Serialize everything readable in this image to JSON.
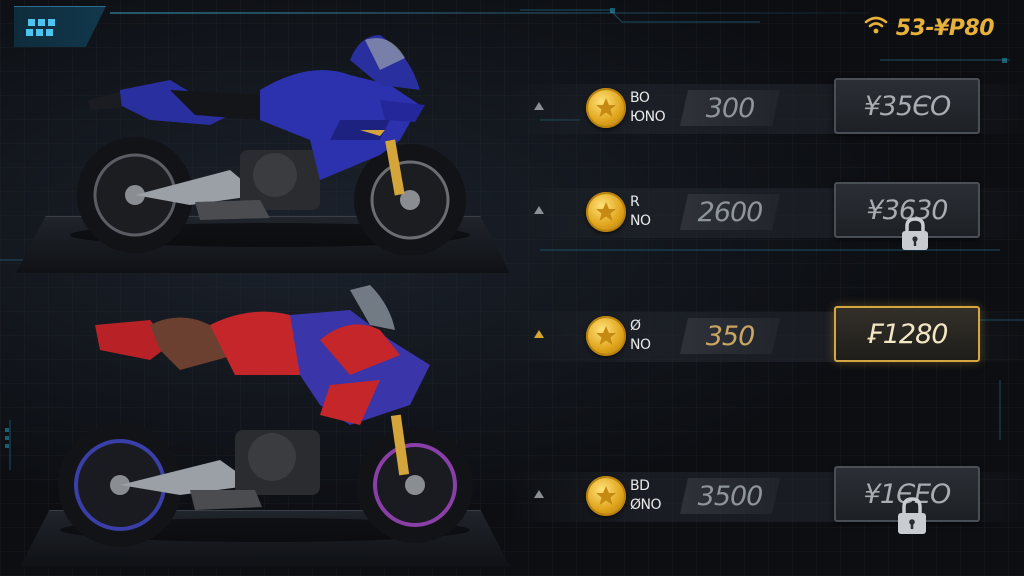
{
  "hud": {
    "menu_icon": "grid-menu-icon",
    "wifi_icon": "wifi-icon",
    "currency_text": "53-¥P80",
    "accent": "#e8b23a"
  },
  "bikes": [
    {
      "color_name": "blue",
      "body": "#2a2fa0",
      "accent": "#d4a53a"
    },
    {
      "color_name": "red",
      "body": "#c4262a",
      "accent": "#3a35a8"
    }
  ],
  "upgrades": [
    {
      "mini_line1": "BO",
      "mini_line2": "ЮNO",
      "cost": "300",
      "price": "¥35ЄO",
      "locked": false,
      "active": false
    },
    {
      "mini_line1": "R",
      "mini_line2": "NO",
      "cost": "2600",
      "price": "¥3630",
      "locked": true,
      "active": false
    },
    {
      "mini_line1": "Ø",
      "mini_line2": "NO",
      "cost": "350",
      "price": "₣1280",
      "locked": false,
      "active": true
    },
    {
      "mini_line1": "BD",
      "mini_line2": "ØNO",
      "cost": "3500",
      "price": "¥1ЄEO",
      "locked": true,
      "active": false
    }
  ]
}
